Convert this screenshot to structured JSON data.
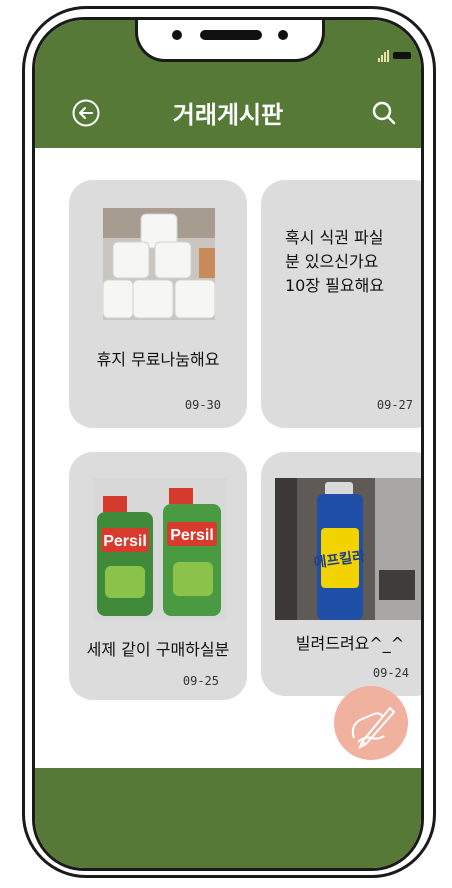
{
  "header": {
    "title": "거래게시판"
  },
  "posts": [
    {
      "title": "휴지 무료나눔해요",
      "date": "09-30",
      "image": "toilet-paper-rolls-photo"
    },
    {
      "body": "혹시 식권 파실\n분 있으신가요\n10장 필요해요",
      "date": "09-27"
    },
    {
      "title": "세제 같이 구매하실분",
      "date": "09-25",
      "image": "persil-detergent-photo",
      "brand": "Persil"
    },
    {
      "title": "빌려드려요^_^",
      "date": "09-24",
      "image": "insect-spray-photo",
      "label": "에프킬라"
    }
  ],
  "colors": {
    "primary": "#567938",
    "card": "#dcdcdc",
    "fab": "#f0b29e"
  },
  "icons": {
    "back": "back-arrow-circle-icon",
    "search": "search-icon",
    "fab": "write-pen-icon"
  }
}
